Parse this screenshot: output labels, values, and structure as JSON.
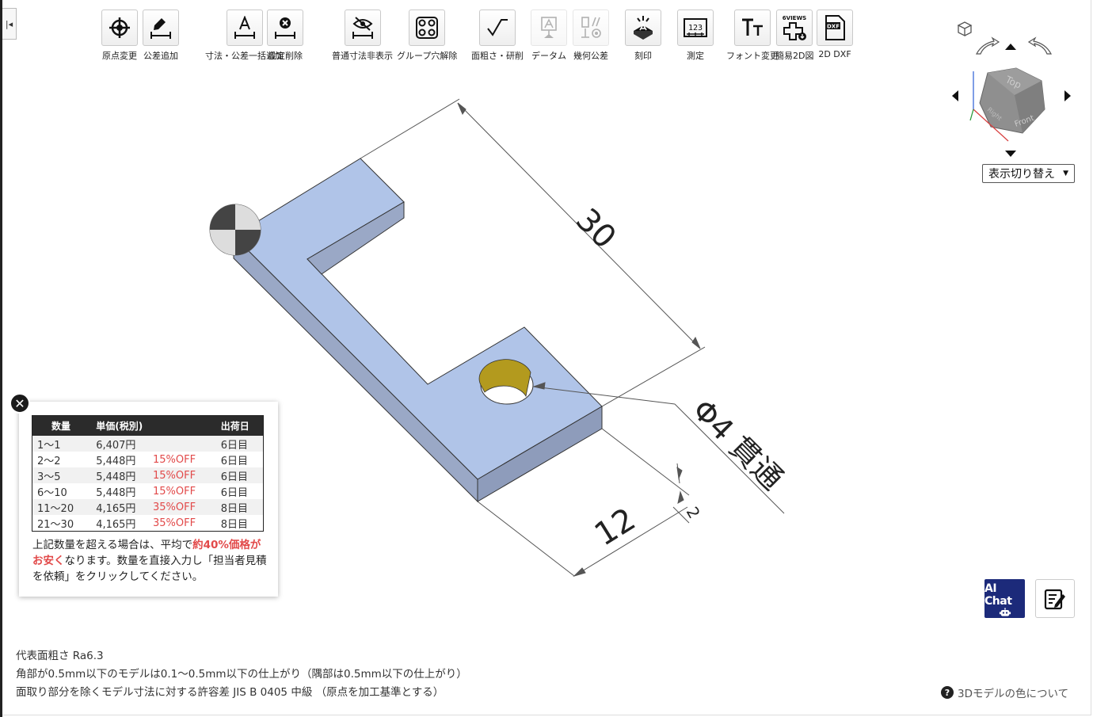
{
  "toolbar": {
    "items": [
      {
        "label": "原点変更",
        "icon": "crosshair-icon"
      },
      {
        "label": "公差追加",
        "icon": "pencil-dimension-icon"
      },
      {
        "label": "寸法・公差一括追加",
        "icon": "text-dimension-icon"
      },
      {
        "label": "設定削除",
        "icon": "delete-dimension-icon"
      },
      {
        "label": "普通寸法非表示",
        "icon": "hide-dimension-icon"
      },
      {
        "label": "グループ穴解除",
        "icon": "ungroup-holes-icon"
      },
      {
        "label": "面粗さ・研削",
        "icon": "surface-roughness-icon"
      },
      {
        "label": "データム",
        "icon": "datum-icon"
      },
      {
        "label": "幾何公差",
        "icon": "geometric-tolerance-icon"
      },
      {
        "label": "刻印",
        "icon": "engrave-icon"
      },
      {
        "label": "測定",
        "icon": "measure-icon"
      },
      {
        "label": "フォント変更",
        "icon": "font-icon"
      },
      {
        "label": "簡易2D図",
        "icon": "six-views-icon"
      },
      {
        "label": "2D DXF",
        "icon": "dxf-file-icon"
      }
    ],
    "icon_texts": {
      "measure": "123",
      "six_views": "6VIEWS",
      "dxf": "DXF"
    }
  },
  "view": {
    "switch_label": "表示切り替え",
    "cube_faces": {
      "top": "Top",
      "front": "Front",
      "right": "Right"
    }
  },
  "model": {
    "dim_length": "30",
    "dim_width": "12",
    "dim_thickness": "2",
    "hole_note": "Φ4 貫通",
    "colors": {
      "face": "#b0c4e8",
      "side": "#9aa8c6",
      "front": "#8e9cbb",
      "edge": "#333333",
      "hole": "#b39a1e"
    }
  },
  "price": {
    "headers": [
      "数量",
      "単価(税別)",
      "",
      "出荷日"
    ],
    "rows": [
      [
        "1〜1",
        "6,407円",
        "",
        "6日目"
      ],
      [
        "2〜2",
        "5,448円",
        "15%OFF",
        "6日目"
      ],
      [
        "3〜5",
        "5,448円",
        "15%OFF",
        "6日目"
      ],
      [
        "6〜10",
        "5,448円",
        "15%OFF",
        "6日目"
      ],
      [
        "11〜20",
        "4,165円",
        "35%OFF",
        "8日目"
      ],
      [
        "21〜30",
        "4,165円",
        "35%OFF",
        "8日目"
      ]
    ],
    "note_before": "上記数量を超える場合は、平均で",
    "note_highlight": "約40%価格がお安く",
    "note_after": "なります。数量を直接入力し「担当者見積を依頼」をクリックしてください。"
  },
  "notes": {
    "line1": "代表面粗さ Ra6.3",
    "line2": "角部が0.5mm以下のモデルは0.1〜0.5mm以下の仕上がり（隅部は0.5mm以下の仕上がり）",
    "line3": "面取り部分を除くモデル寸法に対する許容差 JIS B 0405 中級 （原点を加工基準とする）"
  },
  "help": {
    "color_label": "3Dモデルの色について"
  },
  "chat": {
    "label": "AI Chat"
  }
}
